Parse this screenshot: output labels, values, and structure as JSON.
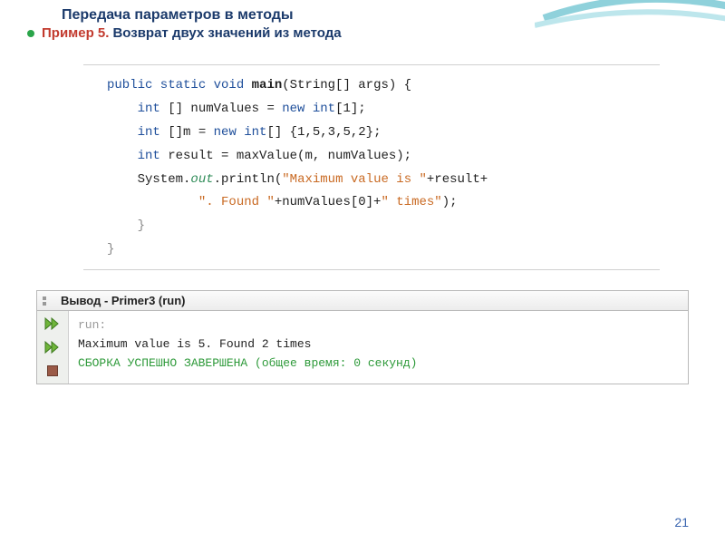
{
  "header": {
    "title": "Передача параметров в методы"
  },
  "bullet": {
    "label": "Пример 5.",
    "text": "Возврат двух значений из метода"
  },
  "code": {
    "l1_kw1": "public static void ",
    "l1_m": "main",
    "l1_sig": "(String[] args) {",
    "l2_pre": "    ",
    "l2_kw": "int",
    "l2_rest": " [] numValues = ",
    "l2_kw2": "new int",
    "l2_end": "[1];",
    "l3_pre": "    ",
    "l3_kw": "int",
    "l3_rest": " []m = ",
    "l3_kw2": "new int",
    "l3_end": "[] {1,5,3,5,2};",
    "l4_pre": "    ",
    "l4_kw": "int",
    "l4_rest": " result = maxValue(m, numValues);",
    "l5_pre": "    System.",
    "l5_field": "out",
    "l5_mid": ".println(",
    "l5_str1": "\"Maximum value is \"",
    "l5_tail": "+result+",
    "l6_pre": "            ",
    "l6_str1": "\". Found \"",
    "l6_mid": "+numValues[0]+",
    "l6_str2": "\" times\"",
    "l6_end": ");",
    "l7": "    }",
    "l8": "}"
  },
  "output": {
    "title": "Вывод - Primer3 (run)",
    "run": "run:",
    "msg": "Maximum value is 5. Found 2 times",
    "build": "СБОРКА УСПЕШНО ЗАВЕРШЕНА (общее время: 0 секунд)"
  },
  "page": {
    "number": "21"
  }
}
